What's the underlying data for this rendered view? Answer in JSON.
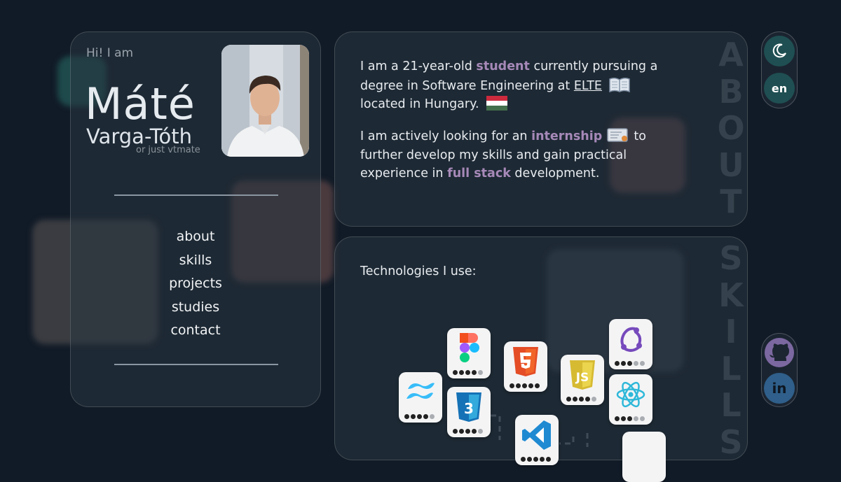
{
  "profile": {
    "greeting": "Hi! I am",
    "first_name": "Máté",
    "last_name": "Varga-Tóth",
    "alias": "or just vtmate"
  },
  "nav": {
    "items": [
      "about",
      "skills",
      "projects",
      "studies",
      "contact"
    ]
  },
  "about": {
    "p1_a": "I am a 21-year-old ",
    "p1_hl": "student",
    "p1_b": " currently pursuing a degree in Software Engineering at ",
    "p1_link": "ELTE",
    "p1_c": " located in Hungary.",
    "p2_a": "I am actively looking for an ",
    "p2_hl": "internship",
    "p2_b": " to further develop my skills and gain practical experience in ",
    "p2_hl2": "full stack",
    "p2_c": " development.",
    "side_label": "ABOUT"
  },
  "skills": {
    "heading": "Technologies I use:",
    "side_label": "SKILLS",
    "technologies": [
      {
        "name": "Figma",
        "level": 4
      },
      {
        "name": "HTML5",
        "level": 5
      },
      {
        "name": "JavaScript",
        "level": 4
      },
      {
        "name": "Redux",
        "level": 3
      },
      {
        "name": "Tailwind CSS",
        "level": 4
      },
      {
        "name": "CSS3",
        "level": 4
      },
      {
        "name": "React",
        "level": 3
      },
      {
        "name": "VS Code",
        "level": 5
      }
    ]
  },
  "toggles": {
    "theme_icon": "moon-icon",
    "language": "en"
  },
  "social": {
    "github_icon": "github-icon",
    "linkedin_icon": "linkedin-icon",
    "linkedin_text": "in"
  },
  "colors": {
    "background": "#111b27",
    "accent": "#a689b8",
    "toggle_teal": "#1f4f52",
    "linkedin_blue": "#2f5f8a"
  }
}
